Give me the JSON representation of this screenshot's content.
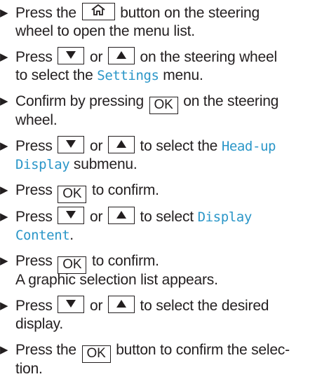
{
  "keys": {
    "home": "home-icon",
    "down": "down-triangle-icon",
    "up": "up-triangle-icon",
    "ok": "OK"
  },
  "colors": {
    "menu_text": "#2a96c8",
    "body_text": "#231f20"
  },
  "steps": [
    {
      "l1_a": "Press the",
      "l1_b": "button on the steering",
      "l2": "wheel to open the menu list."
    },
    {
      "l1_a": "Press",
      "l1_b": "or",
      "l1_c": "on the steering wheel",
      "l2_a": "to select the",
      "l2_menu": "Settings",
      "l2_b": "menu."
    },
    {
      "l1_a": "Confirm by pressing",
      "l1_b": "on the steering",
      "l2": "wheel."
    },
    {
      "l1_a": "Press",
      "l1_b": "or",
      "l1_c": "to select the",
      "l1_menu": "Head-up",
      "l2_menu": "Display",
      "l2_b": "submenu."
    },
    {
      "l1_a": "Press",
      "l1_b": "to confirm."
    },
    {
      "l1_a": "Press",
      "l1_b": "or",
      "l1_c": "to select",
      "l1_menu": "Display",
      "l2_menu": "Content",
      "l2_b": "."
    },
    {
      "l1_a": "Press",
      "l1_b": "to confirm.",
      "l2": "A graphic selection list appears."
    },
    {
      "l1_a": "Press",
      "l1_b": "or",
      "l1_c": "to select the desired",
      "l2": "display."
    },
    {
      "l1_a": "Press the",
      "l1_b": "button to confirm the selec-",
      "l2": "tion."
    }
  ]
}
